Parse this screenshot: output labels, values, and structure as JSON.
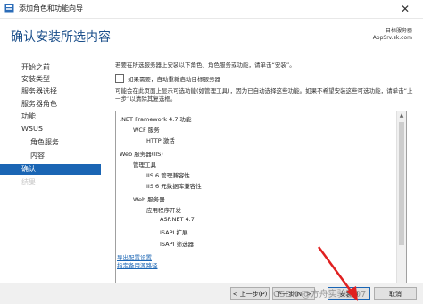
{
  "window": {
    "title": "添加角色和功能向导",
    "close_glyph": "✕"
  },
  "header": {
    "page_title": "确认安装所选内容",
    "target_label": "目标服务器",
    "target_value": "AppSrv.sk.com"
  },
  "nav": {
    "items": [
      {
        "label": "开始之前",
        "state": "normal"
      },
      {
        "label": "安装类型",
        "state": "normal"
      },
      {
        "label": "服务器选择",
        "state": "normal"
      },
      {
        "label": "服务器角色",
        "state": "normal"
      },
      {
        "label": "功能",
        "state": "normal"
      },
      {
        "label": "WSUS",
        "state": "normal"
      },
      {
        "label": "角色服务",
        "state": "sub"
      },
      {
        "label": "内容",
        "state": "sub"
      },
      {
        "label": "确认",
        "state": "active"
      },
      {
        "label": "结果",
        "state": "disabled"
      }
    ]
  },
  "main": {
    "intro": "若要在所选服务器上安装以下角色、角色服务或功能，请单击“安装”。",
    "restart_checkbox": {
      "label": "如果需要，自动重新启动目标服务器",
      "checked": false
    },
    "note": "可能会在此页面上显示可选功能(如管理工具)，因为已自动选择这些功能。如果不希望安装这些可选功能，请单击“上一步”以清除其复选框。",
    "list": [
      {
        "text": ".NET Framework 4.7 功能",
        "level": 0
      },
      {
        "text": "WCF 服务",
        "level": 1
      },
      {
        "text": "HTTP 激活",
        "level": 2
      },
      {
        "text": "Web 服务器(IIS)",
        "level": 0
      },
      {
        "text": "管理工具",
        "level": 1
      },
      {
        "text": "IIS 6 管理兼容性",
        "level": 2
      },
      {
        "text": "IIS 6 元数据库兼容性",
        "level": 3
      },
      {
        "text": "Web 服务器",
        "level": 1
      },
      {
        "text": "应用程序开发",
        "level": 2
      },
      {
        "text": "ASP.NET 4.7",
        "level": 3
      },
      {
        "text": "ISAPI 扩展",
        "level": 3
      },
      {
        "text": "ISAPI 筛选器",
        "level": 3
      }
    ],
    "links": {
      "export": "导出配置设置",
      "alternate_source": "指定备用源路径"
    }
  },
  "footer": {
    "prev": "< 上一步(P)",
    "next": "下一步(N) >",
    "install": "安装(I)",
    "cancel": "取消"
  },
  "watermark": "CSDN @方舟实验室07",
  "colors": {
    "accent": "#1a65b4",
    "annotation_arrow": "#e02020"
  }
}
